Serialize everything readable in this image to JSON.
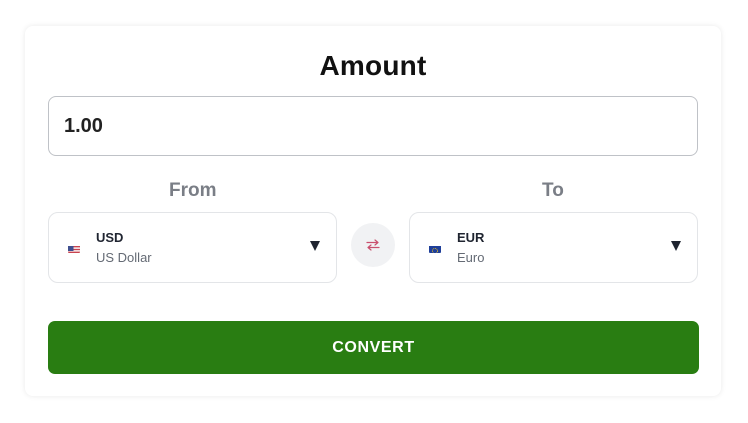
{
  "converter": {
    "title": "Amount",
    "amount_value": "1.00",
    "from": {
      "label": "From",
      "code": "USD",
      "name": "US Dollar",
      "flag_icon": "us-flag-icon"
    },
    "to": {
      "label": "To",
      "code": "EUR",
      "name": "Euro",
      "flag_icon": "eu-flag-icon"
    },
    "swap_icon": "swap-arrows-icon",
    "convert_label": "CONVERT"
  },
  "colors": {
    "convert_button": "#297d12",
    "label_gray": "#7a7e86",
    "swap_icon": "#c94f6d"
  }
}
